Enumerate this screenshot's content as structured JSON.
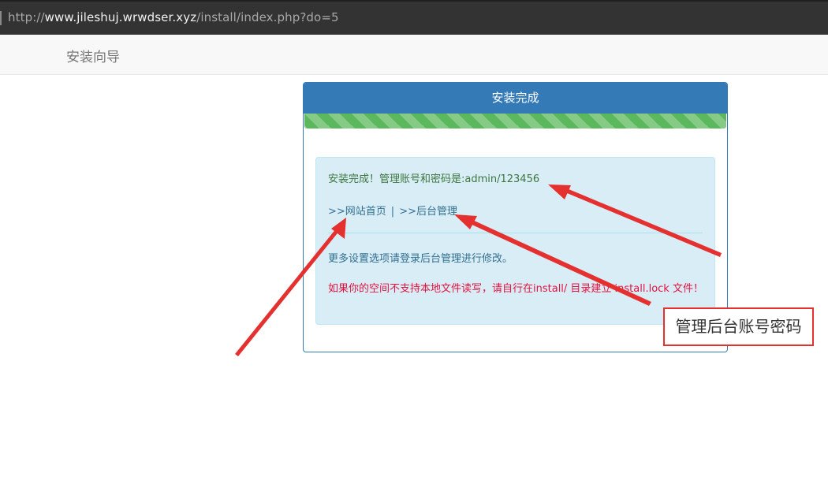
{
  "browser": {
    "url_prefix": "http://",
    "url_host": "www.jileshuj.wrwdser.xyz",
    "url_path": "/install/index.php?do=5"
  },
  "navbar": {
    "brand": "安装向导"
  },
  "panel": {
    "title": "安装完成",
    "progress_percent": 100,
    "success_message": "安装完成！管理账号和密码是:admin/123456",
    "link_home": ">>网站首页",
    "link_separator": "|",
    "link_admin": ">>后台管理",
    "note": "更多设置选项请登录后台管理进行修改。",
    "warning": "如果你的空间不支持本地文件读写，请自行在install/ 目录建立 install.lock 文件！"
  },
  "annotation": {
    "callout_text": "管理后台账号密码",
    "arrow_color": "#e53030"
  }
}
